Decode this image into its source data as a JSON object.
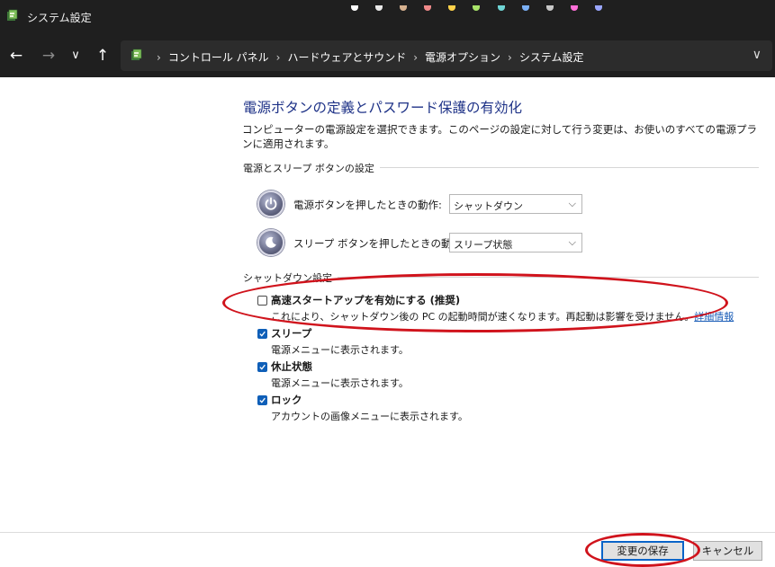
{
  "window": {
    "title": "システム設定"
  },
  "taskbar_colors": [
    "#ffffff",
    "#e9e9e9",
    "#d6b18f",
    "#f08a8a",
    "#ffd24a",
    "#a9e46a",
    "#6fd5d5",
    "#7bb0f5",
    "#c8c8c8",
    "#ff6fd8",
    "#9aa6ff"
  ],
  "nav": {
    "back_glyph": "←",
    "forward_glyph": "→",
    "recent_glyph": "∨",
    "up_glyph": "↑",
    "breadcrumb": [
      "コントロール パネル",
      "ハードウェアとサウンド",
      "電源オプション",
      "システム設定"
    ],
    "separator": "›",
    "dropdown_glyph": "∨"
  },
  "main": {
    "heading": "電源ボタンの定義とパスワード保護の有効化",
    "description": "コンピューターの電源設定を選択できます。このページの設定に対して行う変更は、お使いのすべての電源プランに適用されます。",
    "power_section": {
      "title": "電源とスリープ ボタンの設定",
      "power_button_label": "電源ボタンを押したときの動作:",
      "power_button_value": "シャットダウン",
      "sleep_button_label": "スリープ ボタンを押したときの動作:",
      "sleep_button_value": "スリープ状態"
    },
    "shutdown_section": {
      "title": "シャットダウン設定",
      "options": [
        {
          "title": "高速スタートアップを有効にする (推奨)",
          "desc": "これにより、シャットダウン後の PC の起動時間が速くなります。再起動は影響を受けません。",
          "link": "詳細情報",
          "checked": false
        },
        {
          "title": "スリープ",
          "desc": "電源メニューに表示されます。",
          "checked": true
        },
        {
          "title": "休止状態",
          "desc": "電源メニューに表示されます。",
          "checked": true
        },
        {
          "title": "ロック",
          "desc": "アカウントの画像メニューに表示されます。",
          "checked": true
        }
      ]
    }
  },
  "footer": {
    "save_label": "変更の保存",
    "cancel_label": "キャンセル"
  },
  "colors": {
    "heading": "#1e3287",
    "annotation": "#d0131c",
    "checkbox_checked": "#0f5fb8",
    "link": "#1d5fb8"
  }
}
